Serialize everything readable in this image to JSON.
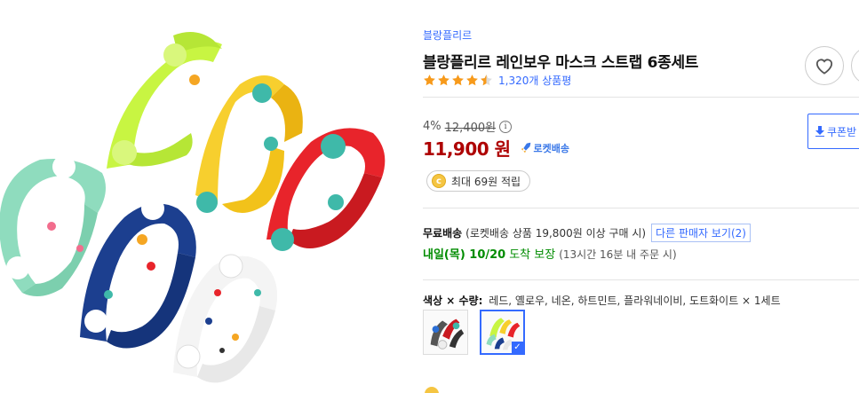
{
  "product": {
    "brand": "블랑플리르",
    "title": "블랑플리르 레인보우 마스크 스트랩 6종세트",
    "rating_stars": 4.5,
    "review_count": "1,320개 상품평"
  },
  "price": {
    "discount_rate": "4%",
    "original_price": "12,400원",
    "info_icon": "i",
    "sale_price": "11,900 원",
    "rocket_label": "로켓배송",
    "coupon_label": "쿠폰받"
  },
  "cashback": {
    "coin_symbol": "c",
    "text": "최대 69원 적립"
  },
  "shipping": {
    "free_label": "무료배송",
    "condition": "(로켓배송 상품 19,800원 이상 구매 시)",
    "other_sellers": "다른 판매자 보기(2)",
    "arrival_day": "내일(목) 10/20",
    "arrival_suffix": "도착 보장",
    "arrival_note": "(13시간 16분 내 주문 시)"
  },
  "option": {
    "label": "색상 × 수량:",
    "value": "레드, 옐로우, 네온, 하트민트, 플라워네이비, 도트화이트 × 1세트",
    "selected_index": 1,
    "check_mark": "✓"
  },
  "icons": {
    "wishlist": "heart-icon",
    "info": "info-icon",
    "rocket": "rocket-icon",
    "download": "download-icon",
    "coin": "coin-icon",
    "check": "check-icon"
  },
  "colors": {
    "link_blue": "#346aff",
    "price_red": "#ae0000",
    "arrival_green": "#008c00",
    "star_orange": "#f79a1b"
  }
}
